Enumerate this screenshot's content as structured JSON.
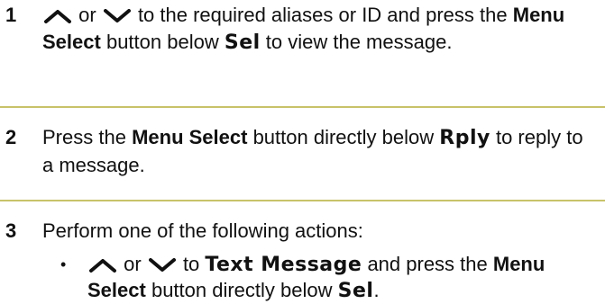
{
  "steps": [
    {
      "number": "1",
      "t1": "or",
      "t2": "to the required aliases or ID and press the",
      "bold1": "Menu Select",
      "t3": "button below",
      "lcd1": "Sel",
      "t4": "to view the message."
    },
    {
      "number": "2",
      "t1": "Press the",
      "bold1": "Menu Select",
      "t2": "button directly below",
      "lcd1": "Rply",
      "t3": "to reply to a message."
    },
    {
      "number": "3",
      "t1": "Perform one of the following actions:",
      "bullet": {
        "marker": "•",
        "t1": "or",
        "t2": "to",
        "lcd1": "Text Message",
        "t3": "and press the",
        "bold1": "Menu Select",
        "t4": "button directly below",
        "lcd2": "Sel",
        "t5": "."
      }
    }
  ],
  "icons": {
    "up": "up-chevron-icon",
    "down": "down-chevron-icon"
  },
  "colors": {
    "rule": "#c8c26a",
    "text": "#111111"
  }
}
